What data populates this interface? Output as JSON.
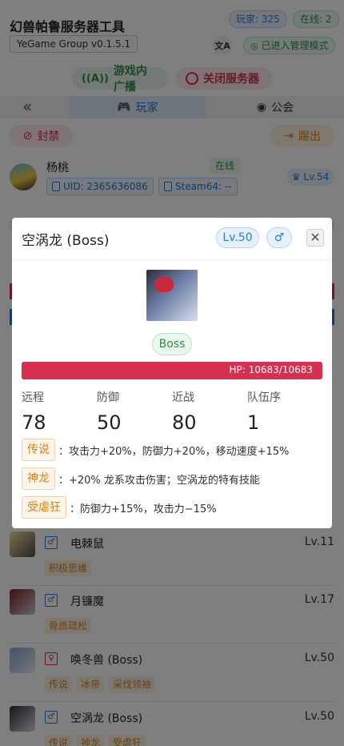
{
  "header": {
    "app_title": "幻兽帕鲁服务器工具",
    "version": "YeGame Group v0.1.5.1",
    "players_count": "玩家: 325",
    "online_count": "在线: 2",
    "translate_icon": "translate-icon",
    "admin_mode": "已进入管理模式"
  },
  "actions": {
    "broadcast": "游戏内广播",
    "shutdown": "关闭服务器"
  },
  "tabs": {
    "players": "玩家",
    "guild": "公会"
  },
  "player_actions": {
    "ban": "封禁",
    "kick": "踢出"
  },
  "player": {
    "name": "杨桃",
    "status": "在线",
    "level": "Lv.54",
    "uid": "UID: 2365636086",
    "steam": "Steam64: --"
  },
  "pal_list": [
    {
      "name": "电棘鼠",
      "level": "Lv.11",
      "gender": "male",
      "gender_symbol": "♂",
      "tags": [
        "积极思维"
      ]
    },
    {
      "name": "月镰魔",
      "level": "Lv.17",
      "gender": "male",
      "gender_symbol": "♂",
      "tags": [
        "骨质疏松"
      ]
    },
    {
      "name": "唤冬兽 (Boss)",
      "level": "Lv.50",
      "gender": "female",
      "gender_symbol": "♀",
      "tags": [
        "传说",
        "冰帝",
        "采伐领袖"
      ]
    },
    {
      "name": "空涡龙 (Boss)",
      "level": "Lv.50",
      "gender": "male",
      "gender_symbol": "♂",
      "tags": [
        "传说",
        "神龙",
        "受虐狂"
      ]
    }
  ],
  "modal": {
    "title": "空涡龙 (Boss)",
    "level": "Lv.50",
    "gender_symbol": "♂",
    "boss_tag": "Boss",
    "hp_text": "HP: 10683/10683",
    "hp_fraction": 1.0,
    "stats": [
      {
        "label": "远程",
        "value": "78"
      },
      {
        "label": "防御",
        "value": "50"
      },
      {
        "label": "近战",
        "value": "80"
      },
      {
        "label": "队伍序",
        "value": "1"
      }
    ],
    "skills": [
      {
        "tag": "传说",
        "desc": "：攻击力+20%，防御力+20%，移动速度+15%"
      },
      {
        "tag": "神龙",
        "desc": "：+20% 龙系攻击伤害；空涡龙的特有技能"
      },
      {
        "tag": "受虐狂",
        "desc": "：防御力+15%，攻击力−15%"
      }
    ]
  },
  "colors": {
    "accent_blue": "#2a7bd1",
    "accent_green": "#2e8f4a",
    "danger_red": "#d5304f",
    "warning_orange": "#d4831e"
  }
}
